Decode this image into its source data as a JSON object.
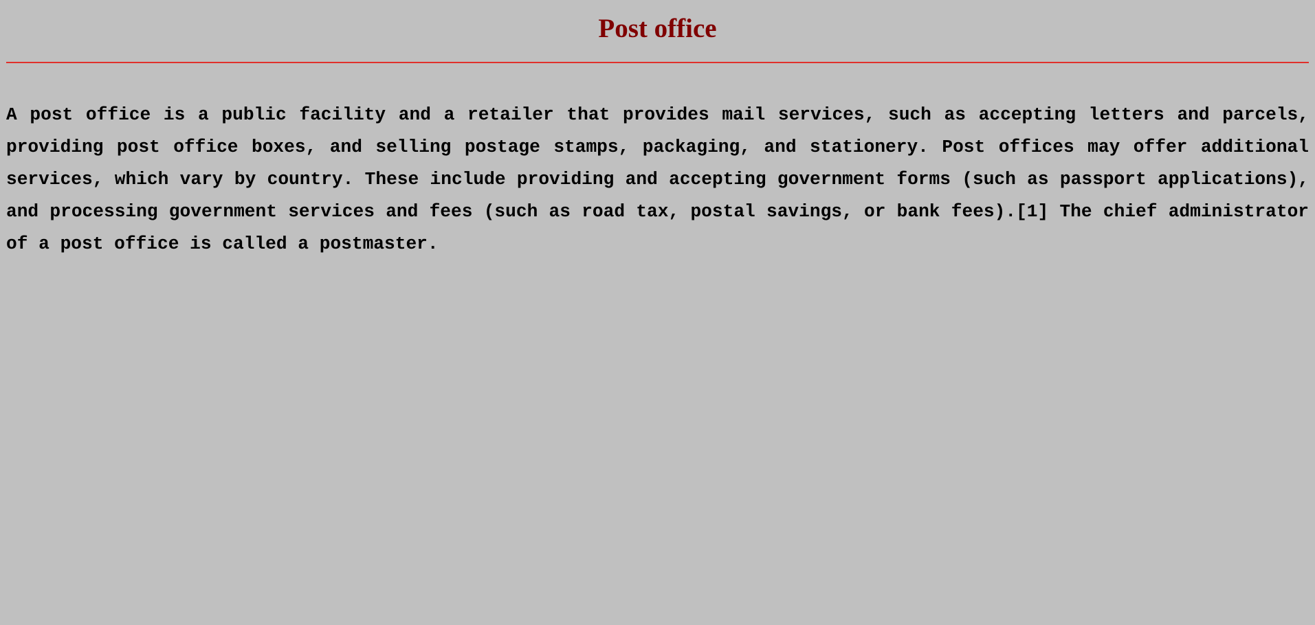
{
  "page": {
    "title": "Post office",
    "paragraph": "A post office is a public facility and a retailer that provides mail services, such as accepting letters and parcels, providing post office boxes, and selling postage stamps, packaging, and stationery. Post offices may offer additional services, which vary by country. These include providing and accepting government forms (such as passport applications), and processing government services and fees (such as road tax, postal savings, or bank fees).[1] The chief administrator of a post office is called a postmaster."
  },
  "colors": {
    "background": "#c0c0c0",
    "title": "#800000",
    "rule": "#e0302b",
    "text": "#000000"
  }
}
